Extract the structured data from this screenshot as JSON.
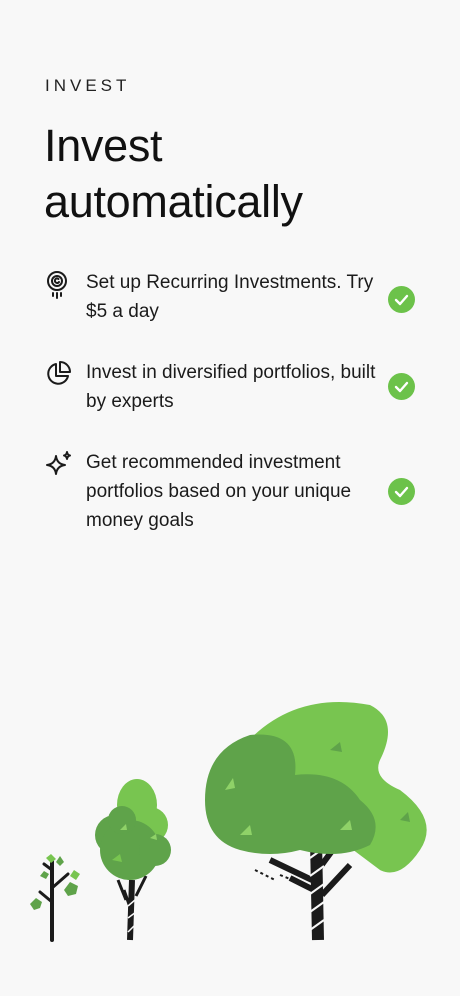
{
  "header": {
    "eyebrow": "INVEST",
    "title": "Invest automatically"
  },
  "features": [
    {
      "icon": "recurring-coin-icon",
      "text": "Set up Recurring Investments. Try $5 a day",
      "checked": true
    },
    {
      "icon": "pie-chart-icon",
      "text": "Invest in diversified portfolios, built by experts",
      "checked": true
    },
    {
      "icon": "sparkle-icon",
      "text": "Get recommended investment portfolios based on your unique money goals",
      "checked": true
    }
  ],
  "colors": {
    "accent_green": "#6cc24a",
    "tree_dark": "#5fa34a",
    "tree_light": "#78c550",
    "background": "#f8f8f8"
  }
}
